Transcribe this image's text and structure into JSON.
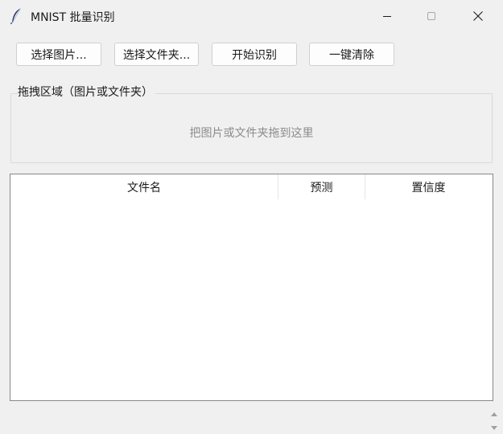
{
  "window": {
    "title": "MNIST 批量识别",
    "icon": "feather-icon"
  },
  "toolbar": {
    "pick_images_label": "选择图片...",
    "pick_folder_label": "选择文件夹...",
    "start_label": "开始识别",
    "clear_label": "一键清除"
  },
  "dropzone": {
    "legend": "拖拽区域（图片或文件夹）",
    "hint": "把图片或文件夹拖到这里"
  },
  "table": {
    "columns": [
      {
        "label": "文件名"
      },
      {
        "label": "预测"
      },
      {
        "label": "置信度"
      }
    ],
    "rows": []
  },
  "colors": {
    "background": "#f0f0f0",
    "button_bg": "#fdfdfd",
    "button_border": "#d0d0d0",
    "table_border": "#828790",
    "hint_text": "#8c8c8c"
  }
}
